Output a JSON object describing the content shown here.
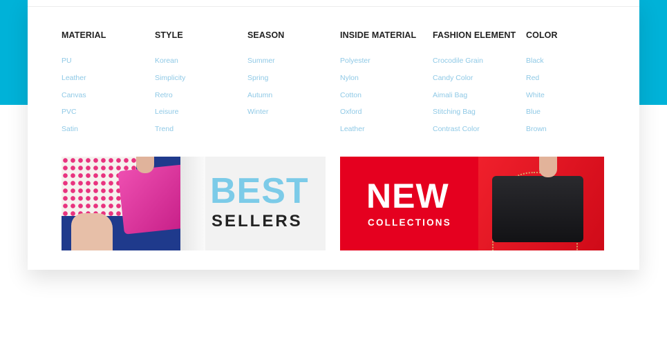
{
  "menu": {
    "columns": [
      {
        "title": "MATERIAL",
        "items": [
          "PU",
          "Leather",
          "Canvas",
          "PVC",
          "Satin"
        ]
      },
      {
        "title": "STYLE",
        "items": [
          "Korean",
          "Simplicity",
          "Retro",
          "Leisure",
          "Trend"
        ]
      },
      {
        "title": "SEASON",
        "items": [
          "Summer",
          "Spring",
          "Autumn",
          "Winter"
        ]
      },
      {
        "title": "INSIDE MATERIAL",
        "items": [
          "Polyester",
          "Nylon",
          "Cotton",
          "Oxford",
          "Leather"
        ]
      },
      {
        "title": "FASHION ELEMENT",
        "items": [
          "Crocodile Grain",
          "Candy Color",
          "Aimali Bag",
          "Stitching Bag",
          "Contrast Color"
        ]
      },
      {
        "title": "COLOR",
        "items": [
          "Black",
          "Red",
          "White",
          "Blue",
          "Brown"
        ]
      }
    ]
  },
  "banners": {
    "best": {
      "title": "BEST",
      "subtitle": "SELLERS"
    },
    "new": {
      "title": "NEW",
      "subtitle": "COLLECTIONS"
    }
  },
  "colors": {
    "accent_band": "#00b2d8",
    "link": "#8fc9e6",
    "heading": "#222222",
    "best_title": "#7ccbe8",
    "new_banner_bg": "#e5001f"
  }
}
